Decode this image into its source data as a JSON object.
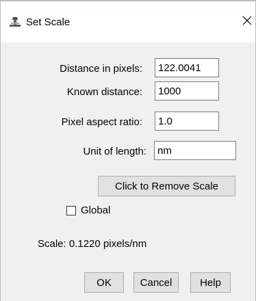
{
  "window": {
    "title": "Set Scale",
    "app_icon": "imagej-microscope-icon",
    "close_icon": "close-icon"
  },
  "form": {
    "distance_label": "Distance in pixels:",
    "distance_value": "122.0041",
    "known_label": "Known distance:",
    "known_value": "1000",
    "aspect_label": "Pixel aspect ratio:",
    "aspect_value": "1.0",
    "unit_label": "Unit of length:",
    "unit_value": "nm",
    "remove_scale_label": "Click to Remove Scale",
    "global_label": "Global",
    "global_checked": false,
    "scale_text": "Scale: 0.1220 pixels/nm"
  },
  "buttons": {
    "ok": "OK",
    "cancel": "Cancel",
    "help": "Help"
  }
}
